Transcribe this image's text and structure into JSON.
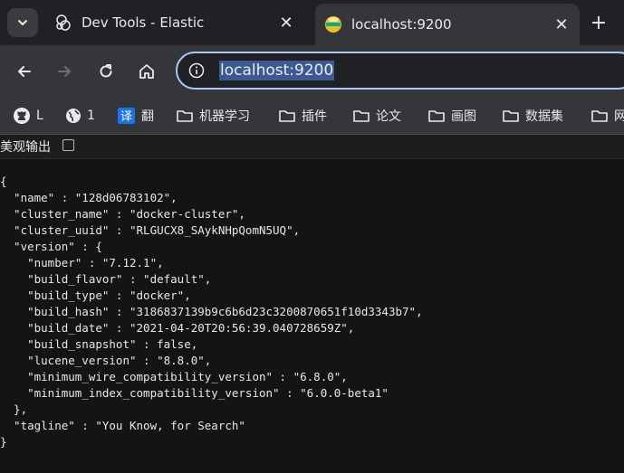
{
  "tabs": [
    {
      "title": "Dev Tools - Elastic",
      "close_label": "✕",
      "favicon": "elastic-icon",
      "active": false
    },
    {
      "title": "localhost:9200",
      "close_label": "✕",
      "favicon": "elasticsearch-icon",
      "active": true
    }
  ],
  "new_tab_label": "+",
  "address_bar": {
    "url": "localhost:9200"
  },
  "bookmarks": [
    {
      "icon": "github-icon",
      "label": "L"
    },
    {
      "icon": "globe-icon",
      "label": "1"
    },
    {
      "icon": "translate-icon",
      "label": "翻"
    },
    {
      "icon": "folder-icon",
      "label": "机器学习"
    },
    {
      "icon": "folder-icon",
      "label": "插件"
    },
    {
      "icon": "folder-icon",
      "label": "论文"
    },
    {
      "icon": "folder-icon",
      "label": "画图"
    },
    {
      "icon": "folder-icon",
      "label": "数据集"
    },
    {
      "icon": "folder-icon",
      "label": "网"
    }
  ],
  "pretty_print": {
    "label": "美观输出",
    "checked": false
  },
  "response_lines": [
    "{",
    "  \"name\" : \"128d06783102\",",
    "  \"cluster_name\" : \"docker-cluster\",",
    "  \"cluster_uuid\" : \"RLGUCX8_SAykNHpQomN5UQ\",",
    "  \"version\" : {",
    "    \"number\" : \"7.12.1\",",
    "    \"build_flavor\" : \"default\",",
    "    \"build_type\" : \"docker\",",
    "    \"build_hash\" : \"3186837139b9c6b6d23c3200870651f10d3343b7\",",
    "    \"build_date\" : \"2021-04-20T20:56:39.040728659Z\",",
    "    \"build_snapshot\" : false,",
    "    \"lucene_version\" : \"8.8.0\",",
    "    \"minimum_wire_compatibility_version\" : \"6.8.0\",",
    "    \"minimum_index_compatibility_version\" : \"6.0.0-beta1\"",
    "  },",
    "  \"tagline\" : \"You Know, for Search\"",
    "}"
  ],
  "colors": {
    "tab_strip": "#202124",
    "toolbar": "#35363a",
    "page_bg": "#141414",
    "omnibox_border": "#a8c7fa",
    "selection": "#3b5a8f"
  }
}
